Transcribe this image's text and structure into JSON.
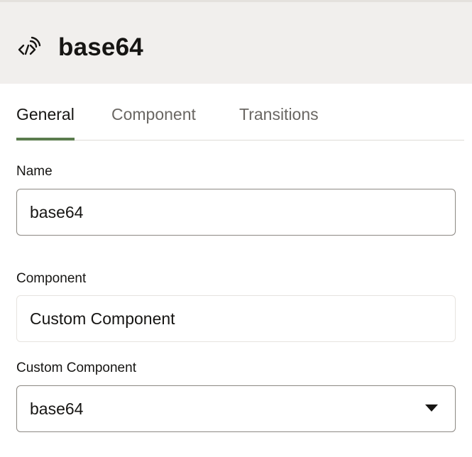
{
  "header": {
    "title": "base64",
    "icon": "custom-component-icon"
  },
  "tabs": [
    {
      "label": "General",
      "active": true
    },
    {
      "label": "Component",
      "active": false
    },
    {
      "label": "Transitions",
      "active": false
    }
  ],
  "form": {
    "name": {
      "label": "Name",
      "value": "base64"
    },
    "component": {
      "label": "Component",
      "value": "Custom Component"
    },
    "custom_component": {
      "label": "Custom Component",
      "selected": "base64",
      "icon": "chevron-down-icon"
    }
  },
  "colors": {
    "header_bg": "#f1efed",
    "active_tab_underline": "#5b7c4e",
    "inactive_tab_text": "#6a6763",
    "text": "#161513"
  }
}
